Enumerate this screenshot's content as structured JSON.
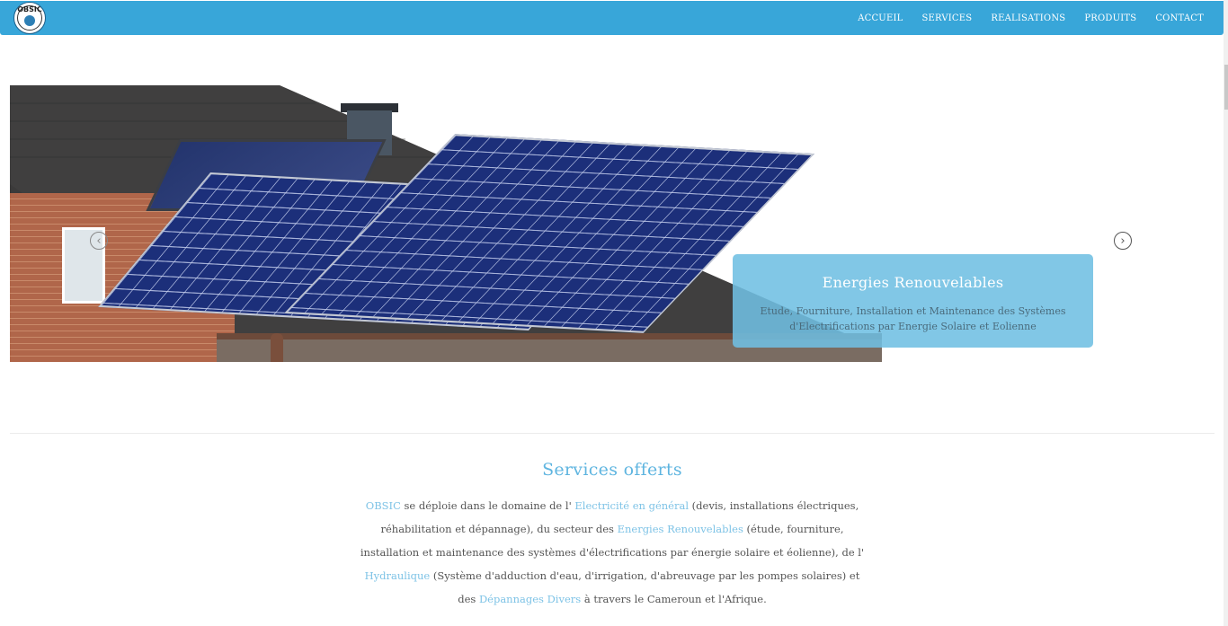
{
  "header": {
    "logo_text": "OBSIC",
    "nav": [
      "ACCUEIL",
      "SERVICES",
      "REALISATIONS",
      "PRODUITS",
      "CONTACT"
    ]
  },
  "carousel": {
    "caption_title": "Energies Renouvelables",
    "caption_text": "Etude, Fourniture, Installation et Maintenance des Systèmes d'Electrifications par Energie Solaire et Eolienne",
    "prev_icon": "chevron-left-icon",
    "next_icon": "chevron-right-icon"
  },
  "services": {
    "title": "Services offerts",
    "p1": "OBSIC",
    "p2": " se déploie dans le domaine de l' ",
    "p3": "Electricité en général",
    "p4": " (devis, installations électriques, réhabilitation et dépannage), du secteur des ",
    "p5": "Energies Renouvelables",
    "p6": " (étude, fourniture, installation et maintenance des systèmes d'électrifications par énergie solaire et éolienne), de l' ",
    "p7": "Hydraulique",
    "p8": " (Système d'adduction d'eau, d'irrigation, d'abreuvage par les pompes solaires) et des ",
    "p9": "Dépannages Divers",
    "p10": " à travers le Cameroun et l'Afrique."
  },
  "colors": {
    "navbar": "#38a6d9",
    "accent": "#5fb5e0",
    "caption_bg": "#6fbfe3"
  }
}
